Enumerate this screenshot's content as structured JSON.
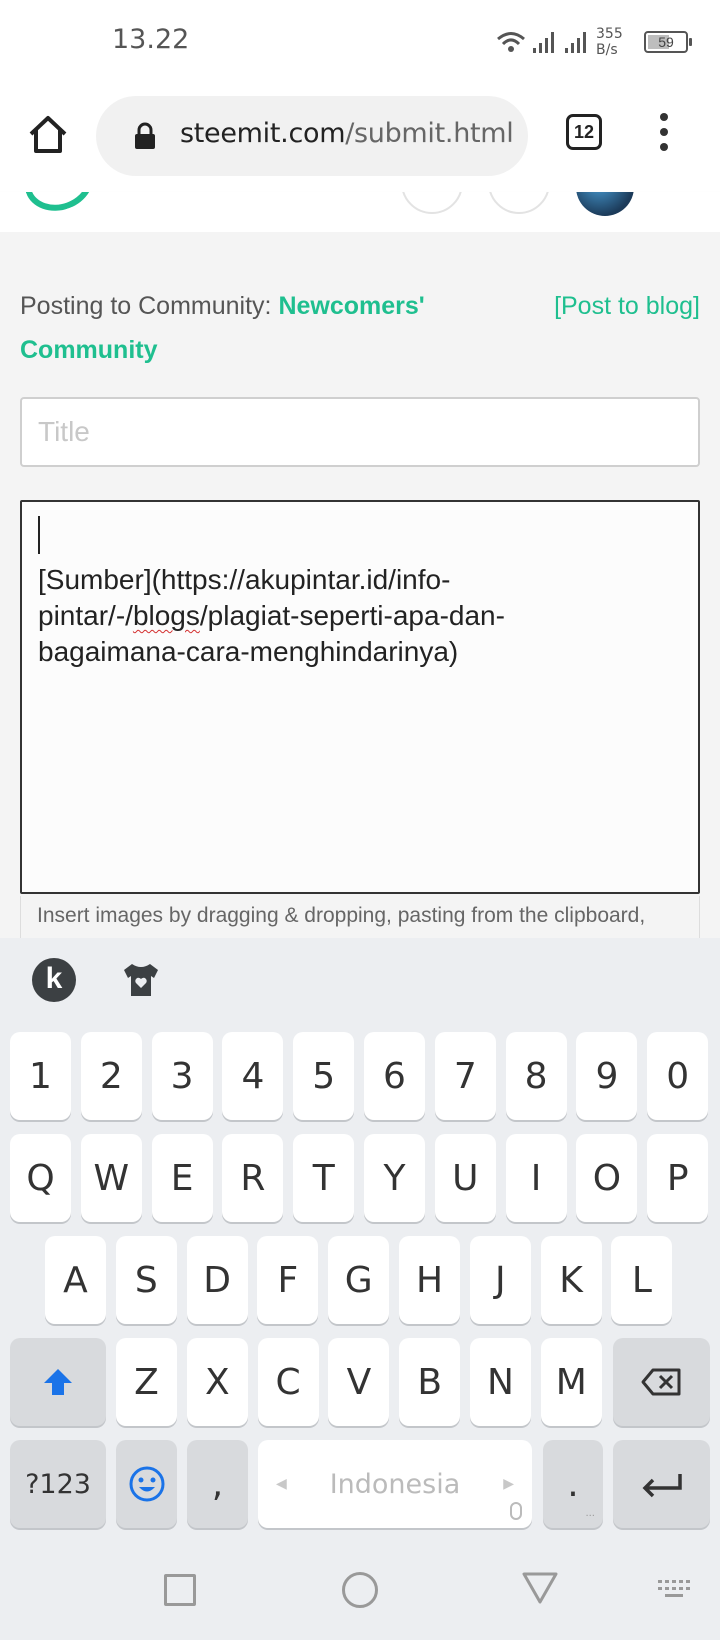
{
  "status_bar": {
    "time": "13.22",
    "net_speed_value": "355",
    "net_speed_unit": "B/s",
    "battery": "59",
    "battery_level_pct": 59
  },
  "browser": {
    "url_host": "steemit.com",
    "url_path": "/submit.html",
    "tab_count": "12"
  },
  "compose": {
    "posting_prefix": "Posting to Community: ",
    "community_name": "Newcomers' Community",
    "post_to_blog": "[Post to blog]",
    "title_placeholder": "Title",
    "body_line1": "[Sumber](https://akupintar.id/info-",
    "body_line2a": "pintar/-/",
    "body_line2b": "blogs",
    "body_line2c": "/plagiat-seperti-apa-dan-",
    "body_line3": "bagaimana-cara-menghindarinya)",
    "hint": "Insert images by dragging & dropping, pasting from the clipboard,"
  },
  "keyboard": {
    "toolbar_k": "k",
    "row1": [
      "1",
      "2",
      "3",
      "4",
      "5",
      "6",
      "7",
      "8",
      "9",
      "0"
    ],
    "row2": [
      "Q",
      "W",
      "E",
      "R",
      "T",
      "Y",
      "U",
      "I",
      "O",
      "P"
    ],
    "row3": [
      "A",
      "S",
      "D",
      "F",
      "G",
      "H",
      "J",
      "K",
      "L"
    ],
    "row4": [
      "Z",
      "X",
      "C",
      "V",
      "B",
      "N",
      "M"
    ],
    "symbols": "?123",
    "comma": ",",
    "space_label": "Indonesia",
    "period": ".",
    "accent_color": "#1a73e8"
  }
}
